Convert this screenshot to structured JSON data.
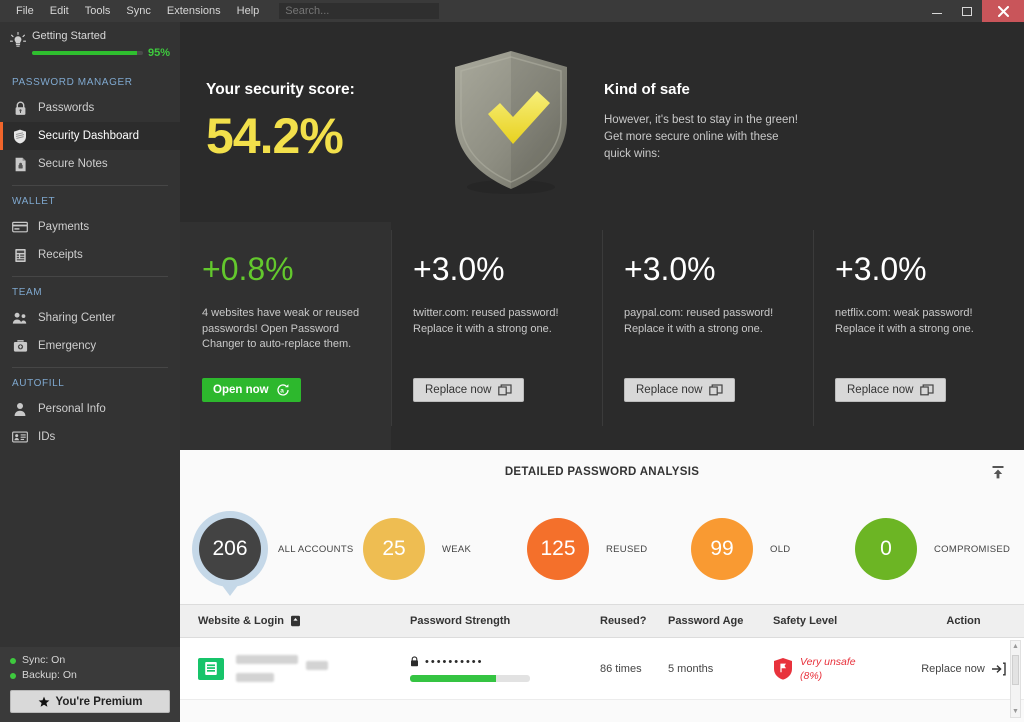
{
  "titlebar": {
    "menu": [
      "File",
      "Edit",
      "Tools",
      "Sync",
      "Extensions",
      "Help"
    ],
    "search_placeholder": "Search...",
    "minimize": "–",
    "maximize": "□",
    "close": "✕"
  },
  "sidebar": {
    "getting_started": {
      "label": "Getting Started",
      "progress_percent": "95%",
      "progress_value": 95,
      "icon": "lightbulb-icon"
    },
    "groups": [
      {
        "label": "PASSWORD MANAGER",
        "items": [
          {
            "label": "Passwords",
            "icon": "lock-icon",
            "active": false
          },
          {
            "label": "Security Dashboard",
            "icon": "shield-icon",
            "active": true
          },
          {
            "label": "Secure Notes",
            "icon": "note-icon",
            "active": false
          }
        ]
      },
      {
        "label": "WALLET",
        "items": [
          {
            "label": "Payments",
            "icon": "credit-card-icon",
            "active": false
          },
          {
            "label": "Receipts",
            "icon": "receipt-icon",
            "active": false
          }
        ]
      },
      {
        "label": "TEAM",
        "items": [
          {
            "label": "Sharing Center",
            "icon": "people-icon",
            "active": false
          },
          {
            "label": "Emergency",
            "icon": "first-aid-kit-icon",
            "active": false
          }
        ]
      },
      {
        "label": "AUTOFILL",
        "items": [
          {
            "label": "Personal Info",
            "icon": "person-icon",
            "active": false
          },
          {
            "label": "IDs",
            "icon": "id-card-icon",
            "active": false
          }
        ]
      }
    ],
    "footer": {
      "sync_status": "Sync: On",
      "backup_status": "Backup: On",
      "premium_label": "You're Premium",
      "premium_icon": "star-icon"
    }
  },
  "hero": {
    "score_label": "Your security score:",
    "score_value": "54.2%",
    "shield_icon": "shield-check-icon",
    "verdict": "Kind of safe",
    "description": "However, it's best to stay in the green! Get more secure online with these quick wins:",
    "description_lines": [
      "However, it's best to stay in the green!",
      "Get more secure online with these",
      "quick wins:"
    ]
  },
  "tips": [
    {
      "gain": "+0.8%",
      "gain_color": "#63c82d",
      "text": "4 websites have weak or reused passwords! Open Password Changer to auto-replace them.",
      "button_label": "Open now",
      "button_style": "green",
      "button_icon": "auto-change-icon",
      "highlighted": true
    },
    {
      "gain": "+3.0%",
      "gain_color": "#ffffff",
      "text": "twitter.com: reused password! Replace it with a strong one.",
      "button_label": "Replace now",
      "button_style": "grey",
      "button_icon": "external-window-icon",
      "highlighted": false
    },
    {
      "gain": "+3.0%",
      "gain_color": "#ffffff",
      "text": "paypal.com: reused password! Replace it with a strong one.",
      "button_label": "Replace now",
      "button_style": "grey",
      "button_icon": "external-window-icon",
      "highlighted": false
    },
    {
      "gain": "+3.0%",
      "gain_color": "#ffffff",
      "text": "netflix.com: weak password! Replace it with a strong one.",
      "button_label": "Replace now",
      "button_style": "grey",
      "button_icon": "external-window-icon",
      "highlighted": false
    }
  ],
  "analysis": {
    "title": "DETAILED PASSWORD ANALYSIS",
    "collapse_icon": "collapse-up-icon",
    "stats": [
      {
        "value": "206",
        "label": "ALL ACCOUNTS",
        "color": "#434343",
        "ring": "#c5d8e8",
        "pin": true
      },
      {
        "value": "25",
        "label": "WEAK",
        "color": "#eebd52",
        "ring": "",
        "pin": false
      },
      {
        "value": "125",
        "label": "REUSED",
        "color": "#f4702b",
        "ring": "",
        "pin": false
      },
      {
        "value": "99",
        "label": "OLD",
        "color": "#f99a32",
        "ring": "",
        "pin": false
      },
      {
        "value": "0",
        "label": "COMPROMISED",
        "color": "#6cb524",
        "ring": "",
        "pin": false
      }
    ],
    "table": {
      "columns": [
        "Website & Login",
        "Password Strength",
        "Reused?",
        "Password Age",
        "Safety Level",
        "Action"
      ],
      "sort_icon": "sort-ascending-icon",
      "rows": [
        {
          "site_icon": "green-site-icon",
          "site_name": "",
          "login": "",
          "password_masked": "••••••••••",
          "lock_icon": "lock-icon",
          "strength_percent": 72,
          "reused": "86 times",
          "age": "5 months",
          "safety_icon": "shield-warning-icon",
          "safety_label": "Very unsafe",
          "safety_value": "(8%)",
          "action_label": "Replace now",
          "action_icon": "arrow-into-bracket-icon"
        }
      ]
    }
  }
}
